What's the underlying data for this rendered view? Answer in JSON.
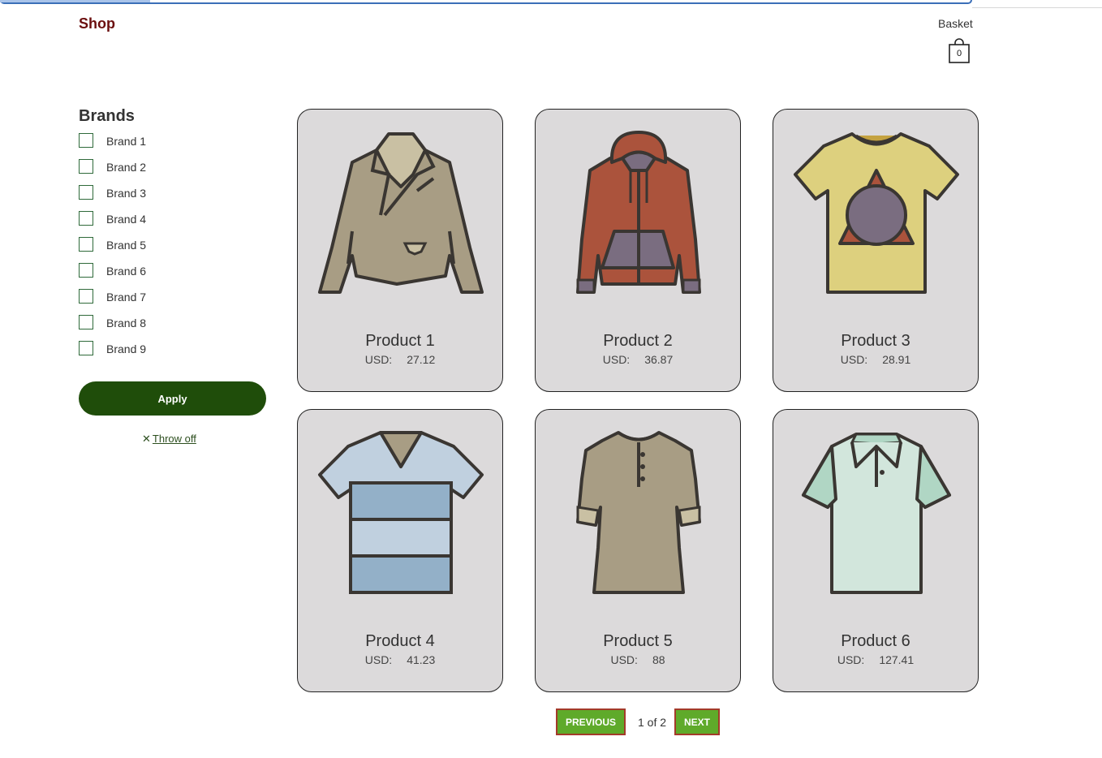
{
  "header": {
    "shop_title": "Shop",
    "basket_label": "Basket",
    "basket_count": "0"
  },
  "filters": {
    "title": "Brands",
    "brands": [
      "Brand 1",
      "Brand 2",
      "Brand 3",
      "Brand 4",
      "Brand 5",
      "Brand 6",
      "Brand 7",
      "Brand 8",
      "Brand 9"
    ],
    "apply_label": "Apply",
    "reset_label": "Throw off",
    "reset_icon": "close-icon"
  },
  "products": [
    {
      "name": "Product 1",
      "currency": "USD:",
      "price": "27.12",
      "icon": "jacket-icon"
    },
    {
      "name": "Product 2",
      "currency": "USD:",
      "price": "36.87",
      "icon": "hoodie-icon"
    },
    {
      "name": "Product 3",
      "currency": "USD:",
      "price": "28.91",
      "icon": "tshirt-triangle-icon"
    },
    {
      "name": "Product 4",
      "currency": "USD:",
      "price": "41.23",
      "icon": "striped-tshirt-icon"
    },
    {
      "name": "Product 5",
      "currency": "USD:",
      "price": "88",
      "icon": "henley-shirt-icon"
    },
    {
      "name": "Product 6",
      "currency": "USD:",
      "price": "127.41",
      "icon": "polo-shirt-icon"
    }
  ],
  "pagination": {
    "prev_label": "PREVIOUS",
    "next_label": "NEXT",
    "page_text": "1 of 2"
  },
  "colors": {
    "brand": "#6b0f0f",
    "apply": "#1f4d0a",
    "pager": "#5faa2a",
    "card_bg": "#dcdadb"
  }
}
